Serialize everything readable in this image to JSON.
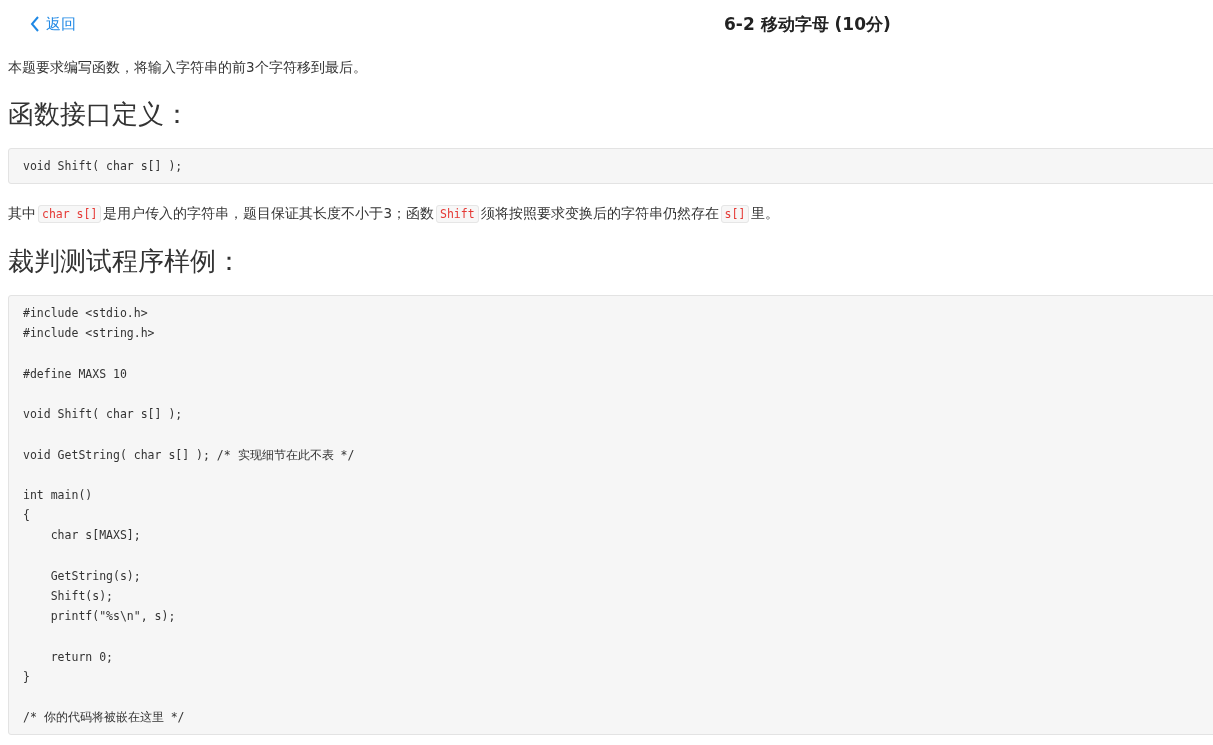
{
  "header": {
    "back_link": "返回",
    "title": "6-2 移动字母 (10分)"
  },
  "content": [
    {
      "kind": "paragraph",
      "segments": [
        {
          "kind": "text",
          "text": "本题要求编写函数，将输入字符串的前3个字符移到最后。"
        }
      ]
    },
    {
      "kind": "heading",
      "text": "函数接口定义："
    },
    {
      "kind": "code",
      "text": "void Shift( char s[] );"
    },
    {
      "kind": "paragraph",
      "segments": [
        {
          "kind": "text",
          "text": "其中"
        },
        {
          "kind": "code",
          "text": "char s[]"
        },
        {
          "kind": "text",
          "text": "是用户传入的字符串，题目保证其长度不小于3；函数"
        },
        {
          "kind": "code",
          "text": "Shift"
        },
        {
          "kind": "text",
          "text": "须将按照要求变换后的字符串仍然存在"
        },
        {
          "kind": "code",
          "text": "s[]"
        },
        {
          "kind": "text",
          "text": "里。"
        }
      ]
    },
    {
      "kind": "heading",
      "text": "裁判测试程序样例："
    },
    {
      "kind": "code",
      "text": "#include <stdio.h>\n#include <string.h>\n\n#define MAXS 10\n\nvoid Shift( char s[] );\n\nvoid GetString( char s[] ); /* 实现细节在此不表 */\n\nint main()\n{\n    char s[MAXS];\n\n    GetString(s);\n    Shift(s);\n    printf(\"%s\\n\", s);\n\n    return 0;\n}\n\n/* 你的代码将被嵌在这里 */"
    }
  ]
}
